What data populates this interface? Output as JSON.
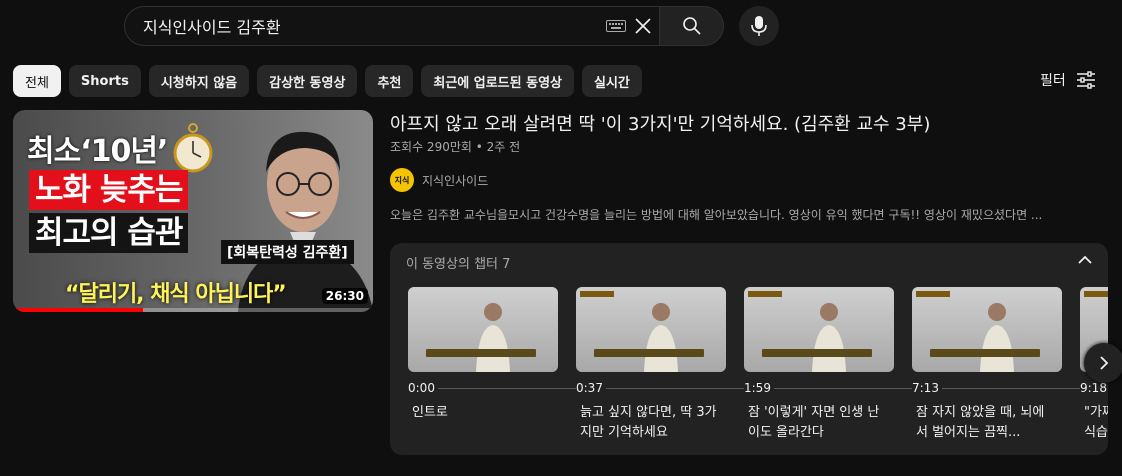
{
  "search": {
    "query": "지식인사이드 김주환"
  },
  "chips": [
    "전체",
    "Shorts",
    "시청하지 않음",
    "감상한 동영상",
    "추천",
    "최근에 업로드된 동영상",
    "실시간"
  ],
  "filter_label": "필터",
  "video": {
    "title": "아프지 않고 오래 살려면 딱 '이 3가지'만 기억하세요. (김주환 교수 3부)",
    "meta": "조회수 290만회 • 2주 전",
    "channel": "지식인사이드",
    "channel_avatar_text": "지식",
    "description": "오늘은 김주환 교수님을모시고 건강수명을 늘리는 방법에 대해 알아보았습니다. 영상이 유익 했다면 구독!! 영상이 재밌으셨다면 ...",
    "duration": "26:30",
    "watch_progress": 0.36,
    "thumb_text": {
      "line1": "최소‘10년’",
      "line2": "노화 늦추는",
      "line3": "최고의 습관",
      "badge": "[회복탄력성 김주환]",
      "quote": "“달리기, 채식 아닙니다”"
    }
  },
  "chapters": {
    "header": "이 동영상의 챕터 7",
    "items": [
      {
        "time": "0:00",
        "label": "인트로"
      },
      {
        "time": "0:37",
        "label": "늙고 싶지 않다면, 딱 3가지만 기억하세요"
      },
      {
        "time": "1:59",
        "label": "잠 '이렇게' 자면 인생 난이도 올라간다"
      },
      {
        "time": "7:13",
        "label": "잠 자지 않았을 때, 뇌에서 벌어지는 끔찍..."
      },
      {
        "time": "9:18",
        "label": "\"가짜 식습"
      }
    ]
  }
}
